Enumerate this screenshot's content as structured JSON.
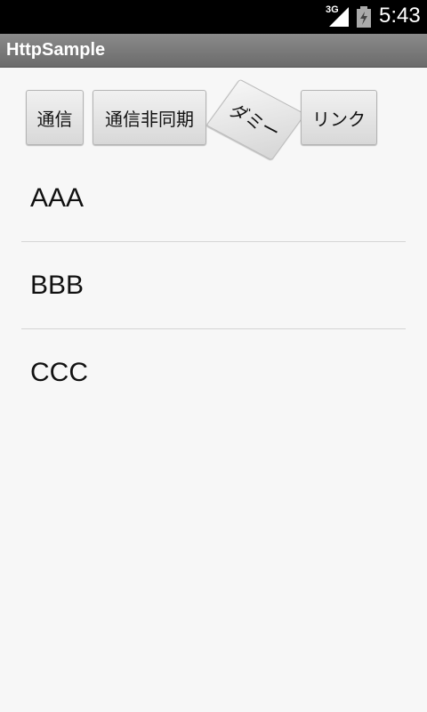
{
  "status_bar": {
    "network": "3G",
    "time": "5:43",
    "icons": [
      "signal-icon",
      "battery-icon"
    ]
  },
  "app": {
    "title": "HttpSample"
  },
  "toolbar": {
    "buttons": [
      {
        "label": "通信"
      },
      {
        "label": "通信非同期"
      },
      {
        "label": "ダミー"
      },
      {
        "label": "リンク"
      }
    ]
  },
  "list": {
    "items": [
      {
        "label": "AAA"
      },
      {
        "label": "BBB"
      },
      {
        "label": "CCC"
      }
    ]
  }
}
